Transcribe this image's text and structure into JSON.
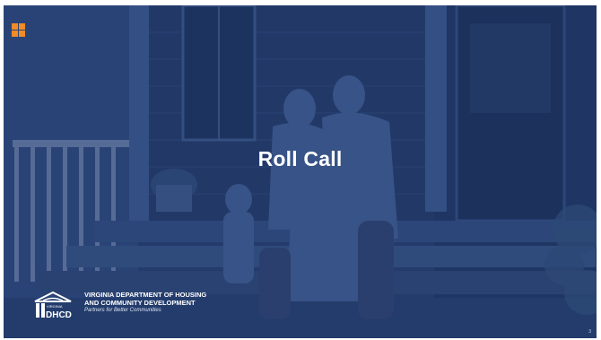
{
  "slide": {
    "title": "Roll Call",
    "page_number": "3",
    "accent_color": "#f28c28",
    "background_color": "#1f3561",
    "icon": "four-square-grid-icon"
  },
  "logo": {
    "icon": "dhcd-logo-icon",
    "small_label": "VIRGINIA",
    "mark_text": "DHCD",
    "line1": "VIRGINIA DEPARTMENT OF HOUSING",
    "line2": "AND COMMUNITY DEVELOPMENT",
    "tagline": "Partners for Better Communities"
  }
}
